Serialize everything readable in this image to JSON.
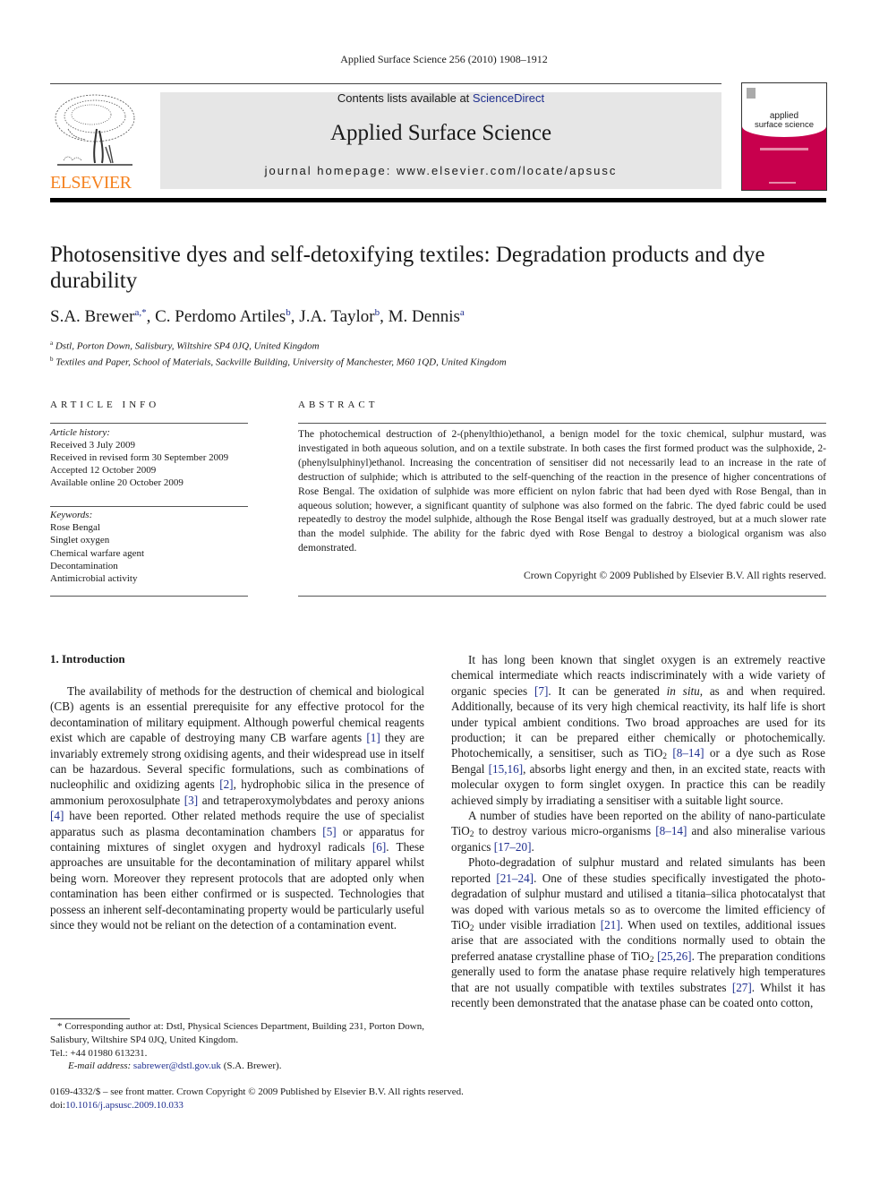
{
  "running_head": "Applied Surface Science 256 (2010) 1908–1912",
  "publisher": {
    "logo_word": "ELSEVIER",
    "logo_color": "#f58220"
  },
  "masthead": {
    "contents_prefix": "Contents lists available at ",
    "contents_link": "ScienceDirect",
    "journal_name": "Applied Surface Science",
    "homepage": "journal homepage: www.elsevier.com/locate/apsusc"
  },
  "cover": {
    "title_line1": "applied",
    "title_line2": "surface science",
    "color": "#c8004d"
  },
  "article": {
    "title": "Photosensitive dyes and self-detoxifying textiles: Degradation products and dye durability",
    "authors": [
      {
        "name": "S.A. Brewer",
        "marks": "a,*"
      },
      {
        "name": "C. Perdomo Artiles",
        "marks": "b"
      },
      {
        "name": "J.A. Taylor",
        "marks": "b"
      },
      {
        "name": "M. Dennis",
        "marks": "a"
      }
    ],
    "affiliations": [
      {
        "mark": "a",
        "text": "Dstl, Porton Down, Salisbury, Wiltshire SP4 0JQ, United Kingdom"
      },
      {
        "mark": "b",
        "text": "Textiles and Paper, School of Materials, Sackville Building, University of Manchester, M60 1QD, United Kingdom"
      }
    ]
  },
  "article_info": {
    "heading": "ARTICLE INFO",
    "history_label": "Article history:",
    "history": [
      "Received 3 July 2009",
      "Received in revised form 30 September 2009",
      "Accepted 12 October 2009",
      "Available online 20 October 2009"
    ],
    "keywords_label": "Keywords:",
    "keywords": [
      "Rose Bengal",
      "Singlet oxygen",
      "Chemical warfare agent",
      "Decontamination",
      "Antimicrobial activity"
    ]
  },
  "abstract": {
    "heading": "ABSTRACT",
    "text": "The photochemical destruction of 2-(phenylthio)ethanol, a benign model for the toxic chemical, sulphur mustard, was investigated in both aqueous solution, and on a textile substrate. In both cases the first formed product was the sulphoxide, 2-(phenylsulphinyl)ethanol. Increasing the concentration of sensitiser did not necessarily lead to an increase in the rate of destruction of sulphide; which is attributed to the self-quenching of the reaction in the presence of higher concentrations of Rose Bengal. The oxidation of sulphide was more efficient on nylon fabric that had been dyed with Rose Bengal, than in aqueous solution; however, a significant quantity of sulphone was also formed on the fabric. The dyed fabric could be used repeatedly to destroy the model sulphide, although the Rose Bengal itself was gradually destroyed, but at a much slower rate than the model sulphide. The ability for the fabric dyed with Rose Bengal to destroy a biological organism was also demonstrated.",
    "copyright": "Crown Copyright © 2009 Published by Elsevier B.V. All rights reserved."
  },
  "introduction": {
    "heading": "1.  Introduction",
    "left_para": [
      {
        "t": "The availability of methods for the destruction of chemical and biological (CB) agents is an essential prerequisite for any effective protocol for the decontamination of military equipment. Although powerful chemical reagents exist which are capable of destroying many CB warfare agents "
      },
      {
        "ref": "[1]"
      },
      {
        "t": " they are invariably extremely strong oxidising agents, and their widespread use in itself can be hazardous. Several specific formulations, such as combinations of nucleophilic and oxidizing agents "
      },
      {
        "ref": "[2]"
      },
      {
        "t": ", hydrophobic silica in the presence of ammonium peroxosulphate "
      },
      {
        "ref": "[3]"
      },
      {
        "t": " and tetraperoxymolybdates and peroxy anions "
      },
      {
        "ref": "[4]"
      },
      {
        "t": " have been reported. Other related methods require the use of specialist apparatus such as plasma decontamination chambers "
      },
      {
        "ref": "[5]"
      },
      {
        "t": " or apparatus for containing mixtures of singlet oxygen and hydroxyl radicals "
      },
      {
        "ref": "[6]"
      },
      {
        "t": ". These approaches are unsuitable for the decontamination of military apparel whilst being worn. Moreover they represent protocols that are adopted only when contamination has been either confirmed or is suspected. Technologies that possess an inherent self-decontaminating property would be particularly useful since they would not be reliant on the detection of a contamination event."
      }
    ],
    "right_paras": [
      [
        {
          "t": "It has long been known that singlet oxygen is an extremely reactive chemical intermediate which reacts indiscriminately with a wide variety of organic species "
        },
        {
          "ref": "[7]"
        },
        {
          "t": ". It can be generated "
        },
        {
          "i": "in situ"
        },
        {
          "t": ", as and when required. Additionally, because of its very high chemical reactivity, its half life is short under typical ambient conditions. Two broad approaches are used for its production; it can be prepared either chemically or photochemically. Photochemically, a sensitiser, such as TiO"
        },
        {
          "sub": "2"
        },
        {
          "t": " "
        },
        {
          "ref": "[8–14]"
        },
        {
          "t": " or a dye such as Rose Bengal "
        },
        {
          "ref": "[15,16]"
        },
        {
          "t": ", absorbs light energy and then, in an excited state, reacts with molecular oxygen to form singlet oxygen. In practice this can be readily achieved simply by irradiating a sensitiser with a suitable light source."
        }
      ],
      [
        {
          "t": "A number of studies have been reported on the ability of nano-particulate TiO"
        },
        {
          "sub": "2"
        },
        {
          "t": " to destroy various micro-organisms "
        },
        {
          "ref": "[8–14]"
        },
        {
          "t": " and also mineralise various organics "
        },
        {
          "ref": "[17–20]"
        },
        {
          "t": "."
        }
      ],
      [
        {
          "t": "Photo-degradation of sulphur mustard and related simulants has been reported "
        },
        {
          "ref": "[21–24]"
        },
        {
          "t": ". One of these studies specifically investigated the photo-degradation of sulphur mustard and utilised a titania–silica photocatalyst that was doped with various metals so as to overcome the limited efficiency of TiO"
        },
        {
          "sub": "2"
        },
        {
          "t": " under visible irradiation "
        },
        {
          "ref": "[21]"
        },
        {
          "t": ". When used on textiles, additional issues arise that are associated with the conditions normally used to obtain the preferred anatase crystalline phase of TiO"
        },
        {
          "sub": "2"
        },
        {
          "t": " "
        },
        {
          "ref": "[25,26]"
        },
        {
          "t": ". The preparation conditions generally used to form the anatase phase require relatively high temperatures that are not usually compatible with textiles substrates "
        },
        {
          "ref": "[27]"
        },
        {
          "t": ". Whilst it has recently been demonstrated that the anatase phase can be coated onto cotton,"
        }
      ]
    ]
  },
  "footnote": {
    "corresponding": "* Corresponding author at: Dstl, Physical Sciences Department, Building 231, Porton Down, Salisbury, Wiltshire SP4 0JQ, United Kingdom.",
    "tel": "Tel.: +44 01980 613231.",
    "email_label": "E-mail address: ",
    "email": "sabrewer@dstl.gov.uk",
    "email_suffix": " (S.A. Brewer)."
  },
  "front_matter": {
    "issn_line": "0169-4332/$ – see front matter. Crown Copyright © 2009 Published by Elsevier B.V. All rights reserved.",
    "doi_prefix": "doi:",
    "doi": "10.1016/j.apsusc.2009.10.033"
  },
  "colors": {
    "link": "#1f2f8f",
    "masthead_bg": "#e6e6e6"
  }
}
